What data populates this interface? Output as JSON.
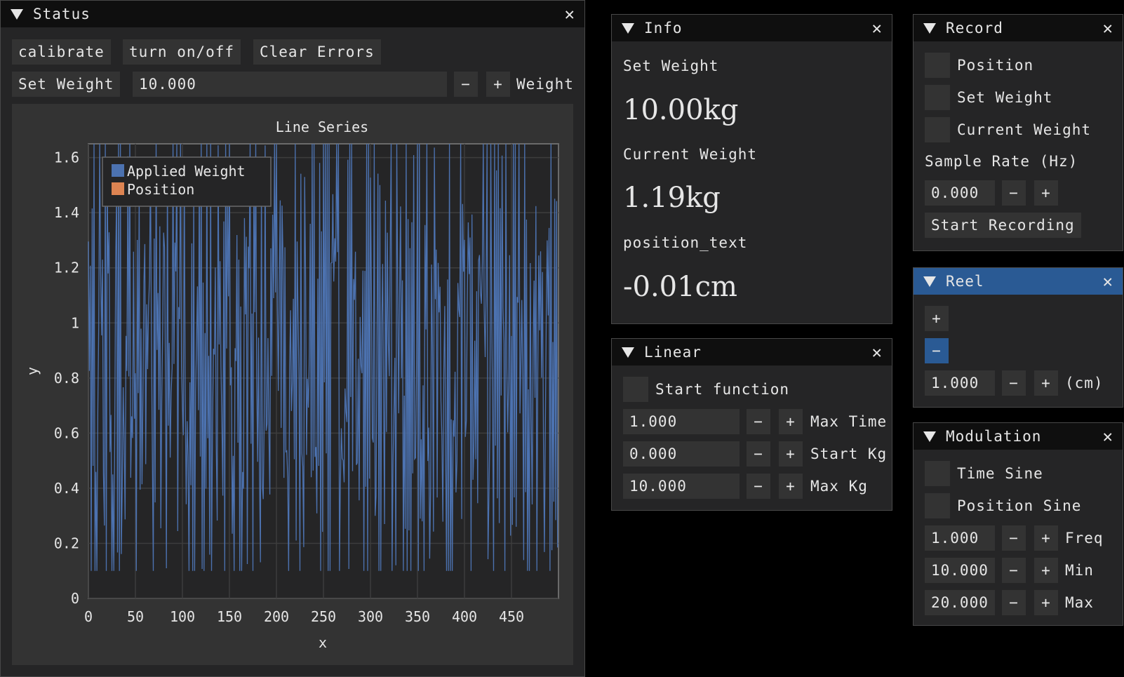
{
  "status": {
    "title": "Status",
    "calibrate_label": "calibrate",
    "turn_label": "turn on/off",
    "clear_label": "Clear Errors",
    "set_weight_label": "Set Weight",
    "weight_value": "10.000",
    "minus": "−",
    "plus": "+",
    "weight_label": "Weight"
  },
  "chart_data": {
    "type": "line",
    "title": "Line Series",
    "xlabel": "x",
    "ylabel": "y",
    "xlim": [
      0,
      500
    ],
    "ylim": [
      0,
      1.65
    ],
    "x_ticks": [
      0,
      50,
      100,
      150,
      200,
      250,
      300,
      350,
      400,
      450
    ],
    "x_tick_labels": [
      "0",
      "50",
      "100",
      "150",
      "200",
      "250",
      "300",
      "350",
      "400",
      "450"
    ],
    "y_ticks": [
      0,
      0.2,
      0.4,
      0.6,
      0.8,
      1,
      1.2,
      1.4,
      1.6
    ],
    "y_tick_labels": [
      "0",
      "0.2",
      "0.4",
      "0.6",
      "0.8",
      "1",
      "1.2",
      "1.4",
      "1.6"
    ],
    "grid": true,
    "legend_position": "top-left",
    "legend": [
      "Applied Weight",
      "Position"
    ],
    "series": [
      {
        "name": "Applied Weight",
        "color": "#4c72b0",
        "values_range": [
          0.1,
          1.65
        ],
        "point_count": 500
      },
      {
        "name": "Position",
        "color": "#dd8452"
      }
    ]
  },
  "info": {
    "title": "Info",
    "set_weight_label": "Set Weight",
    "set_weight_value": "10.00kg",
    "current_weight_label": "Current Weight",
    "current_weight_value": "1.19kg",
    "position_label": "position_text",
    "position_value": "-0.01cm"
  },
  "linear": {
    "title": "Linear",
    "start_function_label": "Start function",
    "rows": [
      {
        "value": "1.000",
        "label": "Max Time"
      },
      {
        "value": "0.000",
        "label": "Start Kg"
      },
      {
        "value": "10.000",
        "label": "Max Kg"
      }
    ]
  },
  "record": {
    "title": "Record",
    "checks": [
      "Position",
      "Set Weight",
      "Current Weight"
    ],
    "sample_rate_label": "Sample Rate (Hz)",
    "sample_rate_value": "0.000",
    "start_recording_label": "Start Recording"
  },
  "reel": {
    "title": "Reel",
    "plus": "+",
    "minus": "−",
    "value": "1.000",
    "unit": "(cm)"
  },
  "modulation": {
    "title": "Modulation",
    "checks": [
      "Time Sine",
      "Position Sine"
    ],
    "rows": [
      {
        "value": "1.000",
        "label": "Freq"
      },
      {
        "value": "10.000",
        "label": "Min"
      },
      {
        "value": "20.000",
        "label": "Max"
      }
    ]
  },
  "colors": {
    "window_bg": "#252526",
    "title_bg": "#0f0f0f",
    "title_active": "#2a5a94",
    "frame_bg": "#333333",
    "series_applied": "#4c72b0",
    "series_position": "#dd8452"
  }
}
